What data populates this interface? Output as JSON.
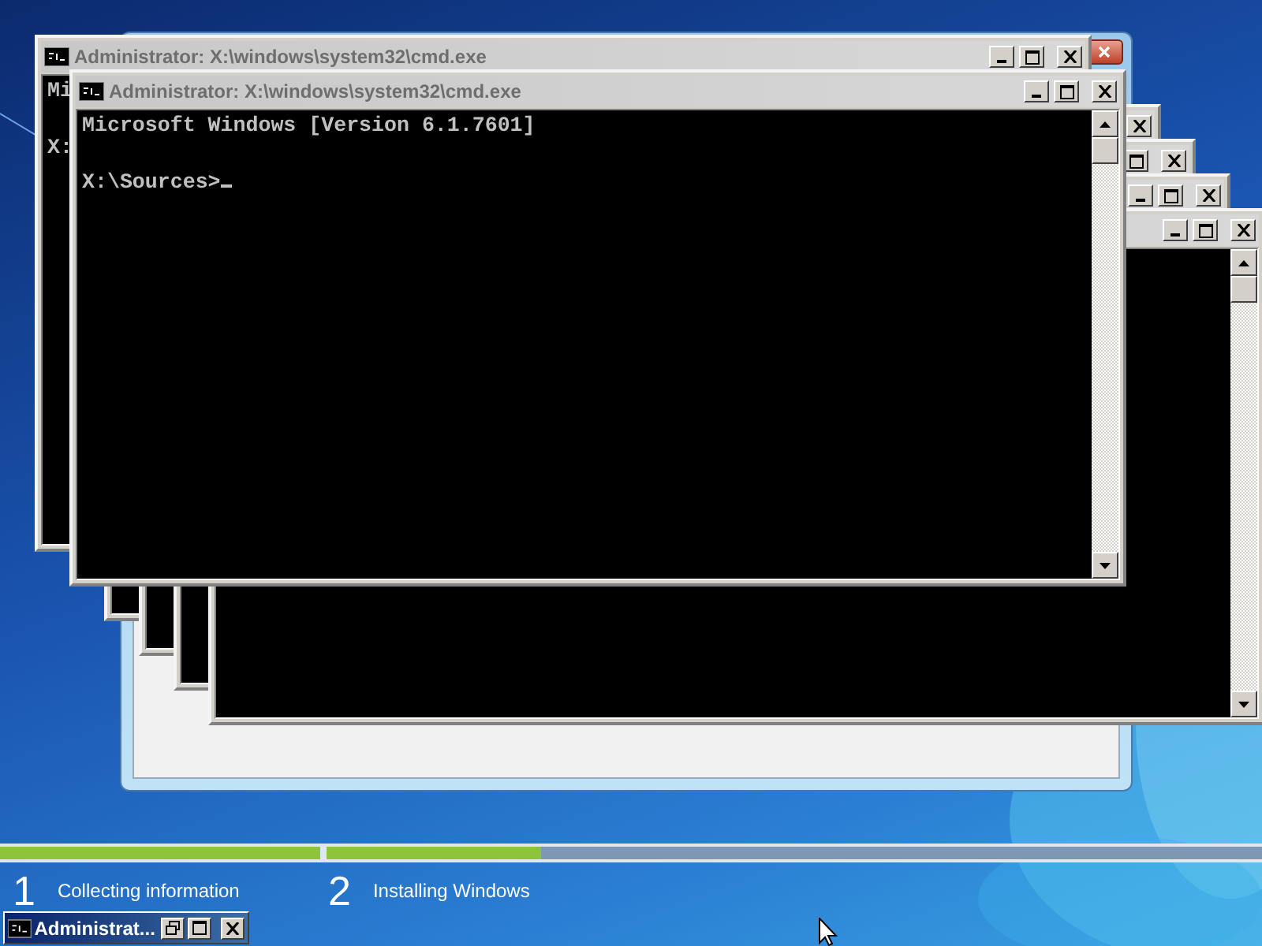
{
  "cmd_windows": [
    {
      "kind": "console",
      "title": "Administrator: X:\\windows\\system32\\cmd.exe",
      "text": "Mi\n\nX:"
    },
    {
      "kind": "console",
      "title": "Administrator: X:\\windows\\system32\\cmd.exe",
      "text": "Microsoft Windows [Version 6.1.7601]\n\nX:\\Sources>",
      "cursor": true
    },
    {
      "kind": "console"
    },
    {
      "kind": "console"
    },
    {
      "kind": "console"
    },
    {
      "kind": "console"
    }
  ],
  "progress": {
    "segments": [
      {
        "level": 1
      },
      {
        "level": 0.23
      }
    ]
  },
  "steps": [
    {
      "number": "1",
      "label": "Collecting information"
    },
    {
      "number": "2",
      "label": "Installing Windows"
    }
  ],
  "minimized_window": {
    "title": "Administrat..."
  }
}
